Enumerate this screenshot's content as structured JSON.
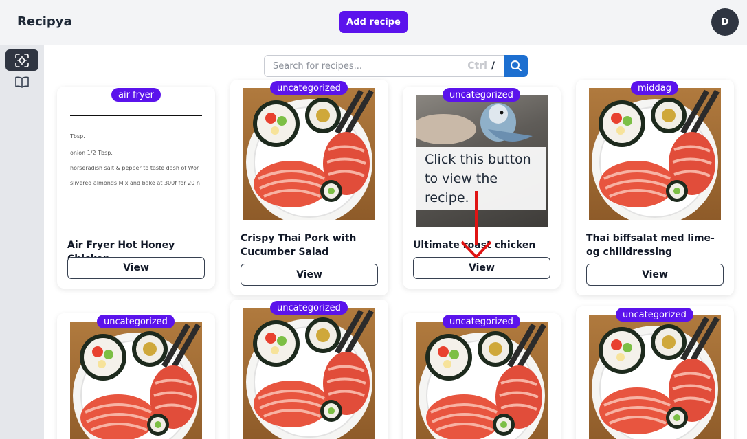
{
  "app": {
    "title": "Recipya"
  },
  "header": {
    "add_label": "Add recipe",
    "avatar_initial": "D"
  },
  "search": {
    "placeholder": "Search for recipes...",
    "shortcut_ctrl": "Ctrl",
    "shortcut_key": "/"
  },
  "overlay": {
    "tip": "Click this button to view the recipe."
  },
  "colors": {
    "accent": "#5b13ec",
    "search_button": "#1d6fd0",
    "sidebar_active": "#2f3541"
  },
  "cards": [
    {
      "category": "air fryer",
      "title": "Air Fryer Hot Honey Chicken",
      "view_label": "View",
      "image": "recipe-document-scan",
      "doc_lines": [
        "Tbsp.",
        "onion 1/2 Tbsp.",
        "horseradish salt & pepper to taste dash of Wor",
        "slivered almonds Mix and bake at 300f for 20 n"
      ]
    },
    {
      "category": "uncategorized",
      "title": "Crispy Thai Pork with Cucumber Salad",
      "view_label": "View",
      "image": "sushi-plate"
    },
    {
      "category": "uncategorized",
      "title": "Ultimate roast chicken",
      "view_label": "View",
      "image": "parakeet-photo"
    },
    {
      "category": "middag",
      "title": "Thai biffsalat med lime- og chilidressing",
      "view_label": "View",
      "image": "sushi-plate"
    },
    {
      "category": "uncategorized",
      "image": "sushi-plate"
    },
    {
      "category": "uncategorized",
      "image": "sushi-plate"
    },
    {
      "category": "uncategorized",
      "image": "sushi-plate"
    },
    {
      "category": "uncategorized",
      "image": "sushi-plate"
    }
  ]
}
